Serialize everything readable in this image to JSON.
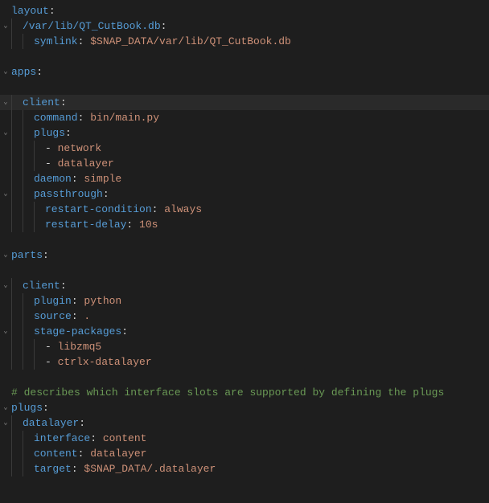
{
  "lines": [
    {
      "g": "",
      "i": 0,
      "seg": [
        {
          "c": "key",
          "t": "layout"
        },
        {
          "c": "punct",
          "t": ":"
        }
      ]
    },
    {
      "g": "v",
      "i": 1,
      "seg": [
        {
          "c": "key",
          "t": "/var/lib/QT_CutBook.db"
        },
        {
          "c": "punct",
          "t": ":"
        }
      ]
    },
    {
      "g": "",
      "i": 2,
      "seg": [
        {
          "c": "key",
          "t": "symlink"
        },
        {
          "c": "punct",
          "t": ": "
        },
        {
          "c": "val",
          "t": "$SNAP_DATA/var/lib/QT_CutBook.db"
        }
      ]
    },
    {
      "g": "",
      "i": 0,
      "seg": []
    },
    {
      "g": "v",
      "i": 0,
      "seg": [
        {
          "c": "key",
          "t": "apps"
        },
        {
          "c": "punct",
          "t": ":"
        }
      ]
    },
    {
      "g": "",
      "i": 0,
      "seg": []
    },
    {
      "g": "v",
      "i": 1,
      "active": true,
      "seg": [
        {
          "c": "key",
          "t": "client"
        },
        {
          "c": "punct",
          "t": ":"
        }
      ]
    },
    {
      "g": "",
      "i": 2,
      "seg": [
        {
          "c": "key",
          "t": "command"
        },
        {
          "c": "punct",
          "t": ": "
        },
        {
          "c": "val",
          "t": "bin/main.py"
        }
      ]
    },
    {
      "g": "v",
      "i": 2,
      "seg": [
        {
          "c": "key",
          "t": "plugs"
        },
        {
          "c": "punct",
          "t": ":"
        }
      ]
    },
    {
      "g": "",
      "i": 3,
      "seg": [
        {
          "c": "punct",
          "t": "- "
        },
        {
          "c": "val",
          "t": "network"
        }
      ]
    },
    {
      "g": "",
      "i": 3,
      "seg": [
        {
          "c": "punct",
          "t": "- "
        },
        {
          "c": "val",
          "t": "datalayer"
        }
      ]
    },
    {
      "g": "",
      "i": 2,
      "seg": [
        {
          "c": "key",
          "t": "daemon"
        },
        {
          "c": "punct",
          "t": ": "
        },
        {
          "c": "val",
          "t": "simple"
        }
      ]
    },
    {
      "g": "v",
      "i": 2,
      "seg": [
        {
          "c": "key",
          "t": "passthrough"
        },
        {
          "c": "punct",
          "t": ":"
        }
      ]
    },
    {
      "g": "",
      "i": 3,
      "seg": [
        {
          "c": "key",
          "t": "restart-condition"
        },
        {
          "c": "punct",
          "t": ": "
        },
        {
          "c": "val",
          "t": "always"
        }
      ]
    },
    {
      "g": "",
      "i": 3,
      "seg": [
        {
          "c": "key",
          "t": "restart-delay"
        },
        {
          "c": "punct",
          "t": ": "
        },
        {
          "c": "val",
          "t": "10s"
        }
      ]
    },
    {
      "g": "",
      "i": 0,
      "seg": []
    },
    {
      "g": "v",
      "i": 0,
      "seg": [
        {
          "c": "key",
          "t": "parts"
        },
        {
          "c": "punct",
          "t": ":"
        }
      ]
    },
    {
      "g": "",
      "i": 0,
      "seg": []
    },
    {
      "g": "v",
      "i": 1,
      "seg": [
        {
          "c": "key",
          "t": "client"
        },
        {
          "c": "punct",
          "t": ":"
        }
      ]
    },
    {
      "g": "",
      "i": 2,
      "seg": [
        {
          "c": "key",
          "t": "plugin"
        },
        {
          "c": "punct",
          "t": ": "
        },
        {
          "c": "val",
          "t": "python"
        }
      ]
    },
    {
      "g": "",
      "i": 2,
      "seg": [
        {
          "c": "key",
          "t": "source"
        },
        {
          "c": "punct",
          "t": ": "
        },
        {
          "c": "val",
          "t": "."
        }
      ]
    },
    {
      "g": "v",
      "i": 2,
      "seg": [
        {
          "c": "key",
          "t": "stage-packages"
        },
        {
          "c": "punct",
          "t": ":"
        }
      ]
    },
    {
      "g": "",
      "i": 3,
      "seg": [
        {
          "c": "punct",
          "t": "- "
        },
        {
          "c": "val",
          "t": "libzmq5"
        }
      ]
    },
    {
      "g": "",
      "i": 3,
      "seg": [
        {
          "c": "punct",
          "t": "- "
        },
        {
          "c": "val",
          "t": "ctrlx-datalayer"
        }
      ]
    },
    {
      "g": "",
      "i": 0,
      "seg": []
    },
    {
      "g": "",
      "i": 0,
      "seg": [
        {
          "c": "cmt",
          "t": "# describes which interface slots are supported by defining the plugs"
        }
      ]
    },
    {
      "g": "v",
      "i": 0,
      "seg": [
        {
          "c": "key",
          "t": "plugs"
        },
        {
          "c": "punct",
          "t": ":"
        }
      ]
    },
    {
      "g": "v",
      "i": 1,
      "seg": [
        {
          "c": "key",
          "t": "datalayer"
        },
        {
          "c": "punct",
          "t": ":"
        }
      ]
    },
    {
      "g": "",
      "i": 2,
      "seg": [
        {
          "c": "key",
          "t": "interface"
        },
        {
          "c": "punct",
          "t": ": "
        },
        {
          "c": "val",
          "t": "content"
        }
      ]
    },
    {
      "g": "",
      "i": 2,
      "seg": [
        {
          "c": "key",
          "t": "content"
        },
        {
          "c": "punct",
          "t": ": "
        },
        {
          "c": "val",
          "t": "datalayer"
        }
      ]
    },
    {
      "g": "",
      "i": 2,
      "seg": [
        {
          "c": "key",
          "t": "target"
        },
        {
          "c": "punct",
          "t": ": "
        },
        {
          "c": "val",
          "t": "$SNAP_DATA/.datalayer"
        }
      ]
    }
  ]
}
